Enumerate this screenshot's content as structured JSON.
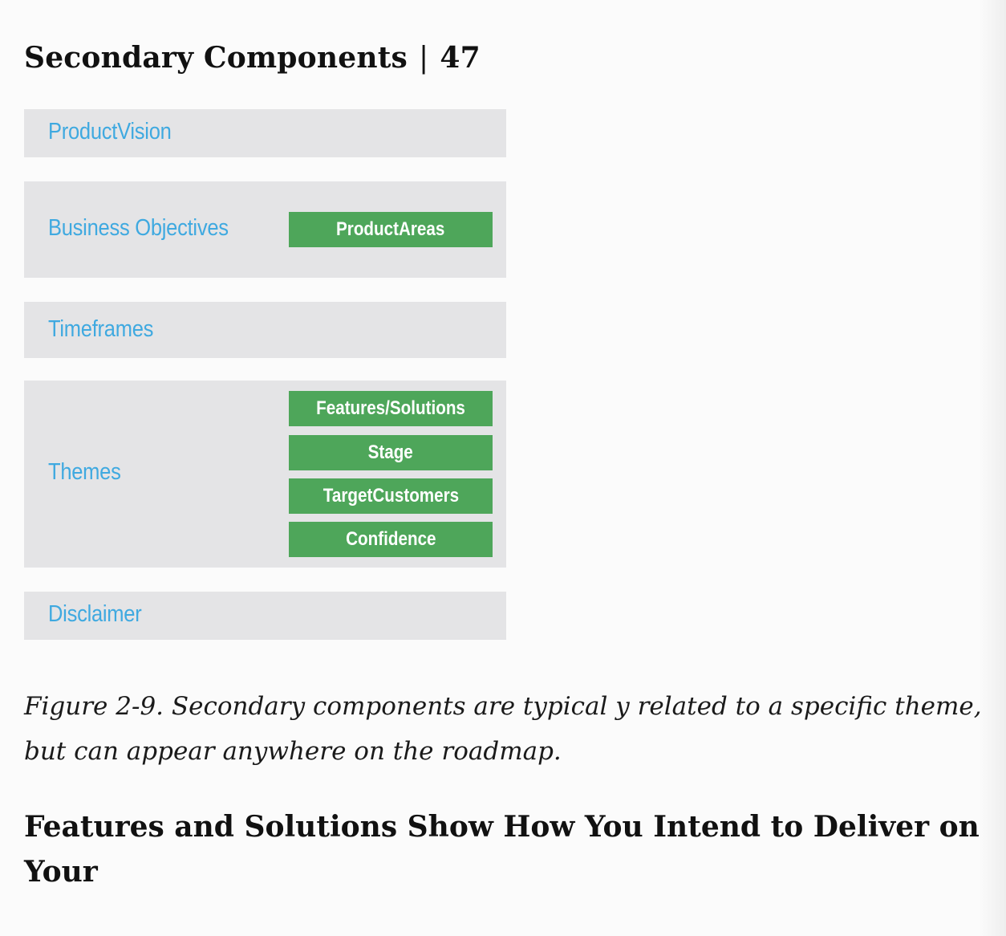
{
  "header": {
    "title": "Secondary Components",
    "separator": "|",
    "page_number": "47"
  },
  "figure": {
    "bands": [
      {
        "label": "ProductVision"
      },
      {
        "label": "Business Objectives",
        "boxes": [
          "ProductAreas"
        ]
      },
      {
        "label": "Timeframes"
      },
      {
        "label": "Themes",
        "boxes": [
          "Features/Solutions",
          "Stage",
          "TargetCustomers",
          "Confidence"
        ]
      },
      {
        "label": "Disclaimer"
      }
    ],
    "colors": {
      "band_background": "#e4e4e6",
      "label_blue": "#3fa9e0",
      "box_green": "#4ea65a"
    }
  },
  "caption": {
    "line1": "Figure 2-9. Secondary components are typical y related to a specific theme,",
    "line2": "but can appear anywhere on the roadmap."
  },
  "section_heading": {
    "line1": "Features and Solutions Show How You Intend to Deliver on",
    "line2": "Your"
  }
}
